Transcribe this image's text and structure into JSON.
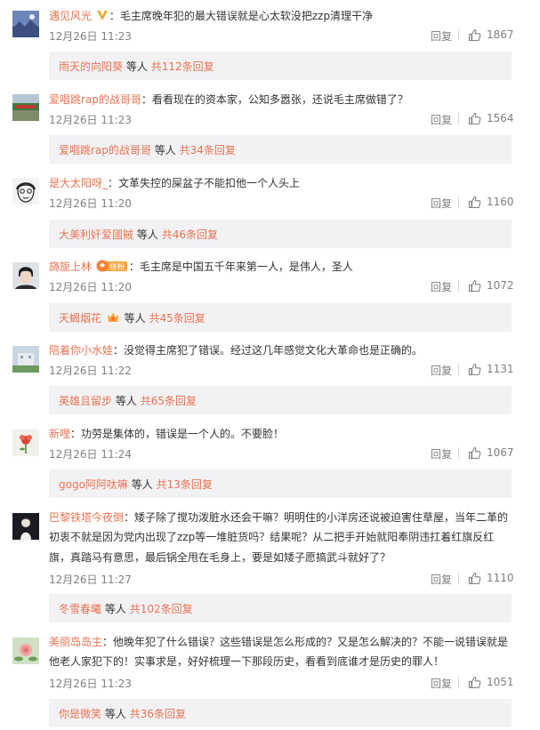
{
  "comments": [
    {
      "name": "遇见风光",
      "badge": "vip",
      "text": "：毛主席晚年犯的最大错误就是心太软没把zzp清理干净",
      "time": "12月26日 11:23",
      "reply": "回复",
      "likes": "1867",
      "sub": {
        "name": "雨天的向阳葵",
        "deng": "等人",
        "count": "共112条回复"
      },
      "avatar": "landscape-avatar"
    },
    {
      "name": "爱唱跳rap的战哥哥",
      "text": "：看看现在的资本家，公知多嚣张，还说毛主席做错了？",
      "time": "12月26日 11:23",
      "reply": "回复",
      "likes": "1564",
      "sub": {
        "name": "爱唱跳rap的战哥哥",
        "deng": "等人",
        "count": "共34条回复"
      },
      "avatar": "outdoor-avatar"
    },
    {
      "name": "是大太阳呀_",
      "text": "：文革失控的屎盆子不能扣他一个人头上",
      "time": "12月26日 11:20",
      "reply": "回复",
      "likes": "1160",
      "sub": {
        "name": "大美利奸爱國賊",
        "deng": "等人",
        "count": "共46条回复"
      },
      "avatar": "sketch-face-avatar"
    },
    {
      "name": "旖旎上林",
      "badge": "fans",
      "badge_text": "铁粉",
      "text": "：毛主席是中国五千年来第一人，是伟人，圣人",
      "time": "12月26日 11:20",
      "reply": "回复",
      "likes": "1072",
      "sub": {
        "name": "天蝎烟花",
        "badge": "fans-small",
        "deng": "等人",
        "count": "共45条回复"
      },
      "avatar": "portrait-avatar"
    },
    {
      "name": "陪着你小水娃",
      "text": "：没觉得主席犯了错误。经过这几年感觉文化大革命也是正确的。",
      "time": "12月26日 11:22",
      "reply": "回复",
      "likes": "1131",
      "sub": {
        "name": "英雄且留步",
        "deng": "等人",
        "count": "共65条回复"
      },
      "avatar": "building-avatar"
    },
    {
      "name": "新哩",
      "text": "：功劳是集体的，错误是一个人的。不要脸！",
      "time": "12月26日 11:24",
      "reply": "回复",
      "likes": "1067",
      "sub": {
        "name": "gogo阿阿呔嘛",
        "deng": "等人",
        "count": "共13条回复"
      },
      "avatar": "flower-avatar"
    },
    {
      "name": "巴黎铁塔今夜倒",
      "text_lines": [
        "：矮子除了搅功泼脏水还会干嘛？明明住的小洋房还说被迫害住草屋，当年⼆革的",
        "初衷不就是因为党内出现了zzp等一堆脏货吗？结果呢？从二把手开始就阳奉阴违扛着红旗反红",
        "旗，真踏马有意思，最后锅全甩在毛身上，要是如矮子愿搞武斗就好了？"
      ],
      "time": "12月26日 11:27",
      "reply": "回复",
      "likes": "1110",
      "sub": {
        "name": "冬雪春曦",
        "deng": "等人",
        "count": "共102条回复"
      },
      "avatar": "dark-figure-avatar"
    },
    {
      "name": "美丽岛岛主",
      "text_lines": [
        "：他晚年犯了什么错误？这些错误是怎么形成的？又是怎么解决的？不能一说错误就是",
        "他老人家犯下的！实事求是，好好梳理一下那段历史，看看到底谁才是历史的罪人！"
      ],
      "time": "12月26日 11:23",
      "reply": "回复",
      "likes": "1051",
      "sub": {
        "name": "你是微笑",
        "deng": "等人",
        "count": "共36条回复"
      },
      "avatar": "rose-avatar"
    }
  ]
}
